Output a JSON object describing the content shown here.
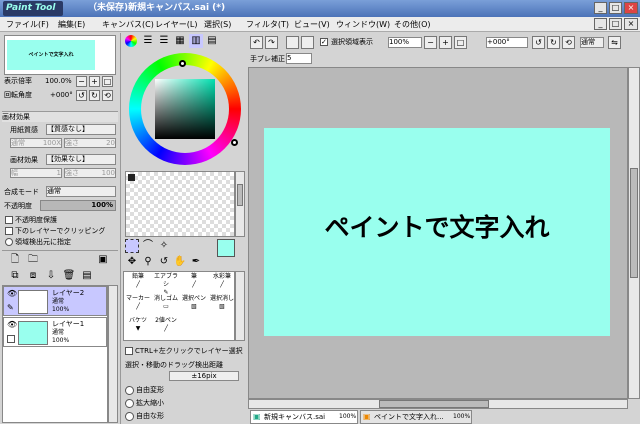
{
  "app": {
    "logo": "Paint Tool SAI",
    "title": "（未保存)新規キャンバス.sai (*)"
  },
  "menu": [
    "ファイル(F)",
    "編集(E)",
    "キャンバス(C)",
    "レイヤー(L)",
    "選択(S)",
    "フィルタ(T)",
    "ビュー(V)",
    "ウィンドウ(W)",
    "その他(O)"
  ],
  "navigator": {
    "preview_text": "ペイントで文字入れ",
    "zoom_label": "表示倍率",
    "zoom_value": "100.0%",
    "rotate_label": "回転角度",
    "rotate_value": "+000°"
  },
  "texture": {
    "section": "画材効果",
    "paper_label": "用紙質感",
    "paper_value": "【質感なし】",
    "paper_sub1": "通常",
    "paper_sub1_val": "100X",
    "paper_sub2": "強さ",
    "paper_sub2_val": "20",
    "effect_label": "画材効果",
    "effect_value": "【効果なし】",
    "effect_sub1": "幅",
    "effect_sub1_val": "1",
    "effect_sub2": "強さ",
    "effect_sub2_val": "100"
  },
  "layer_props": {
    "blend_label": "合成モード",
    "blend_value": "通常",
    "opacity_label": "不透明度",
    "opacity_value": "100%",
    "opacity_fill": 1.0,
    "check1": "不透明度保護",
    "check2": "下のレイヤーでクリッピング",
    "check3": "領域検出元に指定"
  },
  "layers": [
    {
      "name": "レイヤー2",
      "mode": "通常",
      "opacity": "100%"
    },
    {
      "name": "レイヤー1",
      "mode": "通常",
      "opacity": "100%"
    }
  ],
  "tools": {
    "brushes": [
      "鉛筆",
      "エアブラシ",
      "筆",
      "水彩筆",
      "マーカー",
      "消しゴム",
      "選択ペン",
      "選択消し",
      "バケツ",
      "2値ペン"
    ],
    "ctrl_check": "CTRL+左クリックでレイヤー選択",
    "drag_label": "選択・移動のドラッグ検出距離",
    "drag_value": "±16pix",
    "radios": [
      "自由変形",
      "拡大縮小",
      "自由な形"
    ]
  },
  "toolbar": {
    "select_show": "選択領域表示",
    "zoom": "100%",
    "rotate": "+000°",
    "mode": "通常",
    "stabilizer_label": "手ブレ補正",
    "stabilizer_value": "5"
  },
  "canvas": {
    "text": "ペイントで文字入れ",
    "bg": "#99ffee"
  },
  "tabs": [
    {
      "label": "新規キャンバス.sai",
      "zoom": "100%"
    },
    {
      "label": "ペイントで文字入れ...",
      "zoom": "100%"
    }
  ],
  "colors": {
    "accent": "#99ffee",
    "primary": "#99ffee",
    "secondary": "#ffffff"
  }
}
